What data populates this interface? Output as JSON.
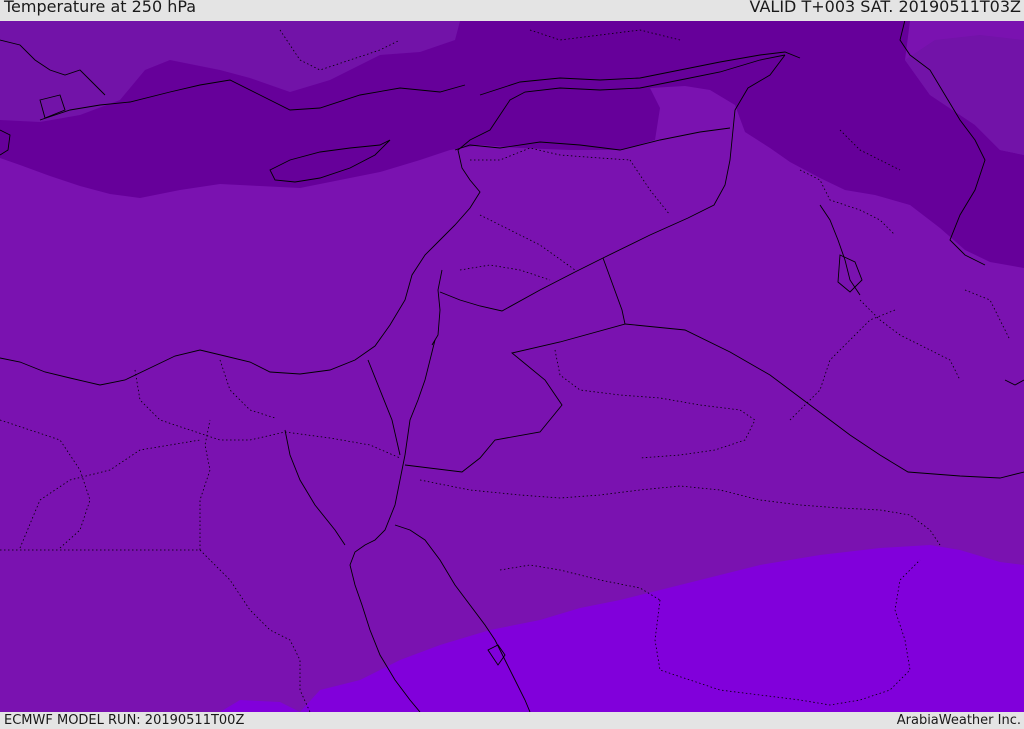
{
  "header": {
    "title": "Temperature at 250 hPa",
    "valid": "VALID T+003 SAT. 20190511T03Z"
  },
  "footer": {
    "model_run": "ECMWF MODEL RUN: 20190511T00Z",
    "credit": "ArabiaWeather Inc."
  },
  "colors": {
    "cold_band": "#66009a",
    "mid_band": "#7a12b0",
    "warm_band": "#8100db",
    "border_line": "#000000"
  }
}
